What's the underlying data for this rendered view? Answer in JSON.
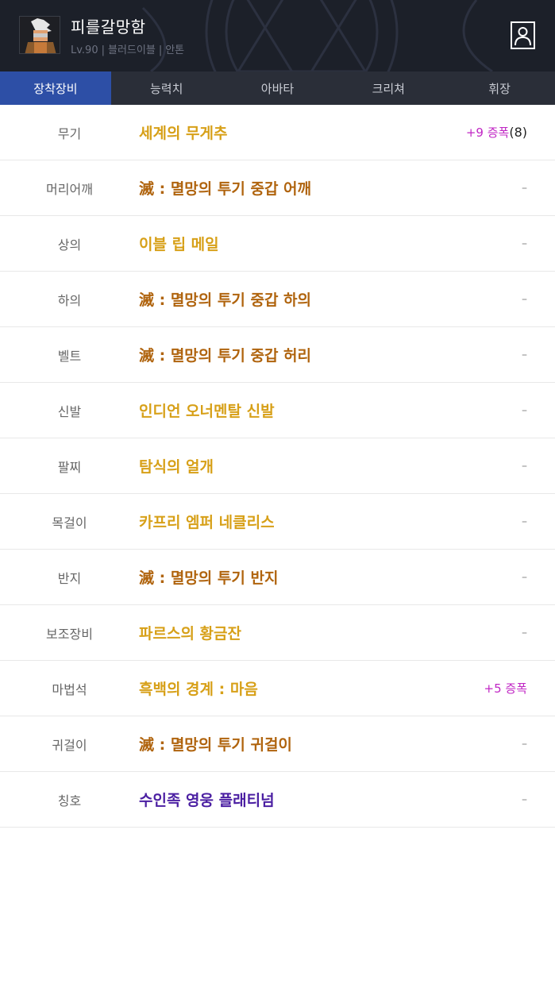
{
  "header": {
    "character_name": "피를갈망함",
    "level": "Lv.90",
    "job": "블러드이블",
    "server": "안톤",
    "separator": "|",
    "profile_icon": "profile-icon"
  },
  "colors": {
    "legendary": "#d7a018",
    "epic": "#b0640e",
    "rare": "#4b1fa2",
    "amplify": "#c026c4",
    "active_tab": "#2d4fa6"
  },
  "tabs": [
    {
      "label": "장착장비",
      "active": true
    },
    {
      "label": "능력치",
      "active": false
    },
    {
      "label": "아바타",
      "active": false
    },
    {
      "label": "크리쳐",
      "active": false
    },
    {
      "label": "휘장",
      "active": false
    }
  ],
  "equipment": [
    {
      "slot": "무기",
      "item": "세계의 무게추",
      "rarity": "legendary",
      "amp": "+9 증폭",
      "count": "(8)",
      "dash": ""
    },
    {
      "slot": "머리어깨",
      "item": "滅 : 멸망의 투기 중갑 어깨",
      "rarity": "epic",
      "amp": "",
      "count": "",
      "dash": "–"
    },
    {
      "slot": "상의",
      "item": "이블 립 메일",
      "rarity": "legendary",
      "amp": "",
      "count": "",
      "dash": "–"
    },
    {
      "slot": "하의",
      "item": "滅 : 멸망의 투기 중갑 하의",
      "rarity": "epic",
      "amp": "",
      "count": "",
      "dash": "–"
    },
    {
      "slot": "벨트",
      "item": "滅 : 멸망의 투기 중갑 허리",
      "rarity": "epic",
      "amp": "",
      "count": "",
      "dash": "–"
    },
    {
      "slot": "신발",
      "item": "인디언 오너멘탈 신발",
      "rarity": "legendary",
      "amp": "",
      "count": "",
      "dash": "–"
    },
    {
      "slot": "팔찌",
      "item": "탐식의 얼개",
      "rarity": "legendary",
      "amp": "",
      "count": "",
      "dash": "–"
    },
    {
      "slot": "목걸이",
      "item": "카프리 엠퍼 네클리스",
      "rarity": "legendary",
      "amp": "",
      "count": "",
      "dash": "–"
    },
    {
      "slot": "반지",
      "item": "滅 : 멸망의 투기 반지",
      "rarity": "epic",
      "amp": "",
      "count": "",
      "dash": "–"
    },
    {
      "slot": "보조장비",
      "item": "파르스의 황금잔",
      "rarity": "legendary",
      "amp": "",
      "count": "",
      "dash": "–"
    },
    {
      "slot": "마법석",
      "item": "흑백의 경계 : 마음",
      "rarity": "legendary",
      "amp": "+5 증폭",
      "count": "",
      "dash": ""
    },
    {
      "slot": "귀걸이",
      "item": "滅 : 멸망의 투기 귀걸이",
      "rarity": "epic",
      "amp": "",
      "count": "",
      "dash": "–"
    },
    {
      "slot": "칭호",
      "item": "수인족 영웅 플래티넘",
      "rarity": "rare",
      "amp": "",
      "count": "",
      "dash": "–"
    }
  ]
}
